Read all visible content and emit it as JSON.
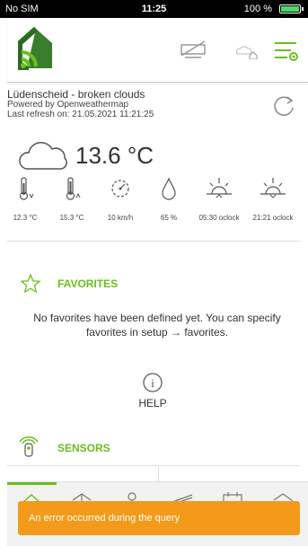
{
  "statusbar": {
    "carrier": "No SIM",
    "time": "11:25",
    "battery": "100 %"
  },
  "header": {
    "logo": "home-logo-icon",
    "icons": [
      "device-disabled-icon",
      "cloud-home-icon",
      "menu-settings-icon"
    ],
    "accent": "#6abf1e"
  },
  "weather": {
    "city": "Lüdenscheid - broken clouds",
    "powered_by": "Powered by Openweathermap",
    "last_refresh": "Last refresh on: 21.05.2021 11:21:25",
    "temperature": "13.6 °C",
    "metrics": [
      {
        "icon": "thermometer-min-icon",
        "value": "12.3 °C"
      },
      {
        "icon": "thermometer-max-icon",
        "value": "15.3 °C"
      },
      {
        "icon": "wind-icon",
        "value": "10 km/h"
      },
      {
        "icon": "humidity-icon",
        "value": "65 %"
      },
      {
        "icon": "sunrise-icon",
        "value": "05:30 oclock"
      },
      {
        "icon": "sunset-icon",
        "value": "21:21 oclock"
      }
    ]
  },
  "favorites": {
    "title": "FAVORITES",
    "empty_text": "No favorites have been defined yet. You can specify favorites in setup → favorites."
  },
  "help": {
    "label": "HELP"
  },
  "sensors": {
    "title": "SENSORS"
  },
  "bottomnav": {
    "tabs": [
      {
        "icon": "home-tab-icon",
        "active": true
      },
      {
        "icon": "shutter-tab-icon",
        "active": false
      },
      {
        "icon": "light-tab-icon",
        "active": false
      },
      {
        "icon": "heating-tab-icon",
        "active": false
      },
      {
        "icon": "timer-tab-icon",
        "active": false
      },
      {
        "icon": "scene-tab-icon",
        "active": false
      }
    ]
  },
  "toast": {
    "message": "An error occurred during the query",
    "color": "#f39a1b"
  }
}
